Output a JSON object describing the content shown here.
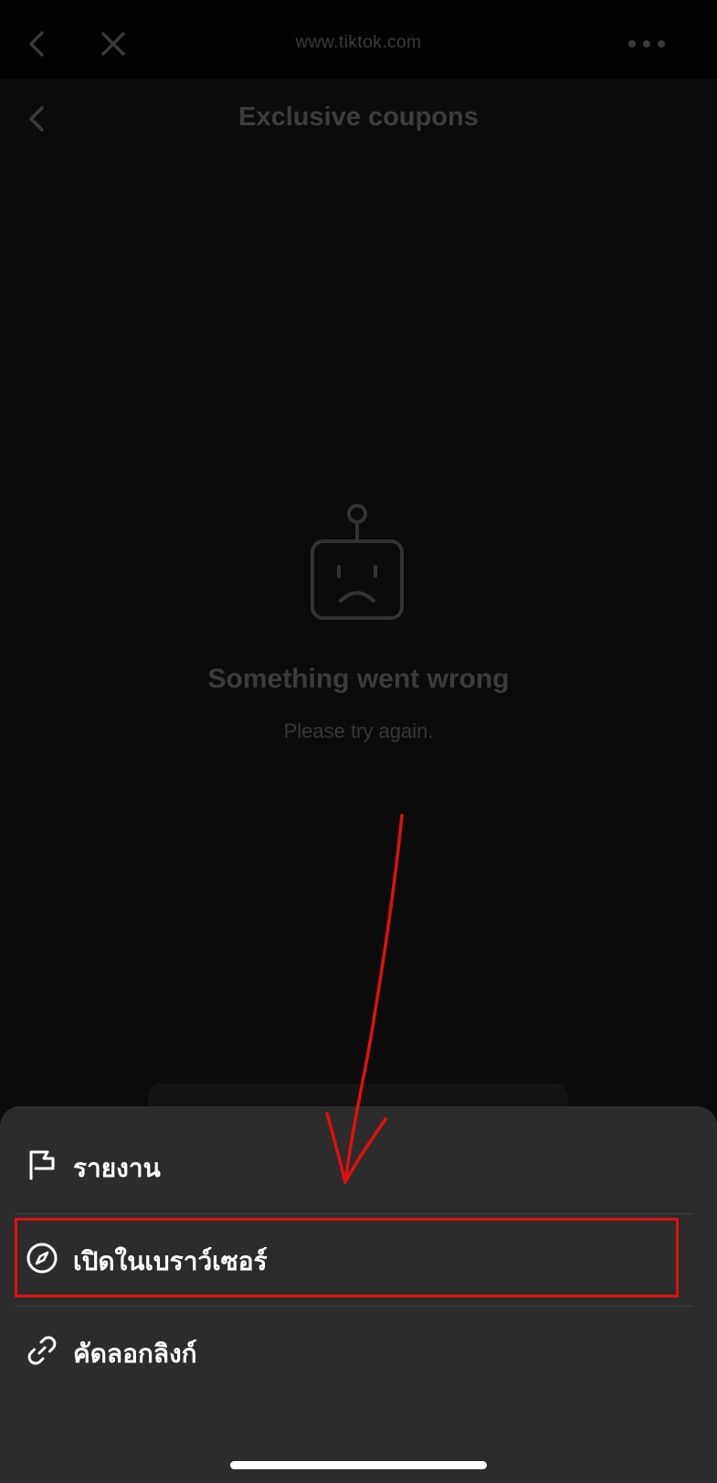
{
  "browser": {
    "url": "www.tiktok.com",
    "back_icon": "chevron-left-icon",
    "close_icon": "close-icon",
    "more_icon": "more-horizontal-icon"
  },
  "page": {
    "title": "Exclusive coupons",
    "back_icon": "chevron-left-icon"
  },
  "error": {
    "icon": "sad-robot-icon",
    "title": "Something went wrong",
    "subtitle": "Please try again."
  },
  "sheet": {
    "items": [
      {
        "label": "รายงาน",
        "icon": "flag-icon"
      },
      {
        "label": "เปิดในเบราว์เซอร์",
        "icon": "compass-icon"
      },
      {
        "label": "คัดลอกลิงก์",
        "icon": "link-icon"
      }
    ]
  },
  "colors": {
    "background": "#0b0b0b",
    "sheet": "#2c2c2c",
    "annotation": "#e01010",
    "dim_text": "#3d3d3d"
  }
}
